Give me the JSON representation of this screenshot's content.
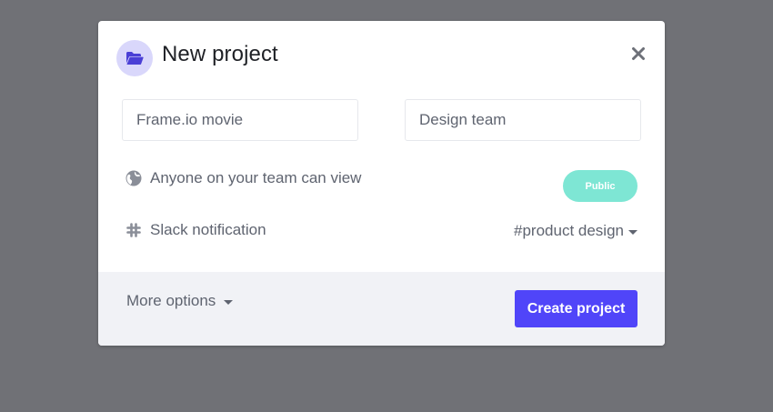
{
  "modal": {
    "title": "New project",
    "header_icon": "folder-open-icon",
    "close_icon": "close-icon"
  },
  "form": {
    "project_name_value": "Frame.io movie",
    "team_value": "Design team"
  },
  "visibility": {
    "label": "Anyone on your team can view",
    "icon": "globe-icon",
    "toggle_label": "Public"
  },
  "slack": {
    "label": "Slack notification",
    "icon": "slack-icon",
    "channel": "#product design"
  },
  "footer": {
    "more_options_label": "More options",
    "create_label": "Create project"
  },
  "colors": {
    "backdrop": "#707176",
    "accent": "#5045f9",
    "public_pill": "#7ee6d4",
    "icon_bg": "#d9d7fb",
    "footer_bg": "#f1f2f6"
  }
}
